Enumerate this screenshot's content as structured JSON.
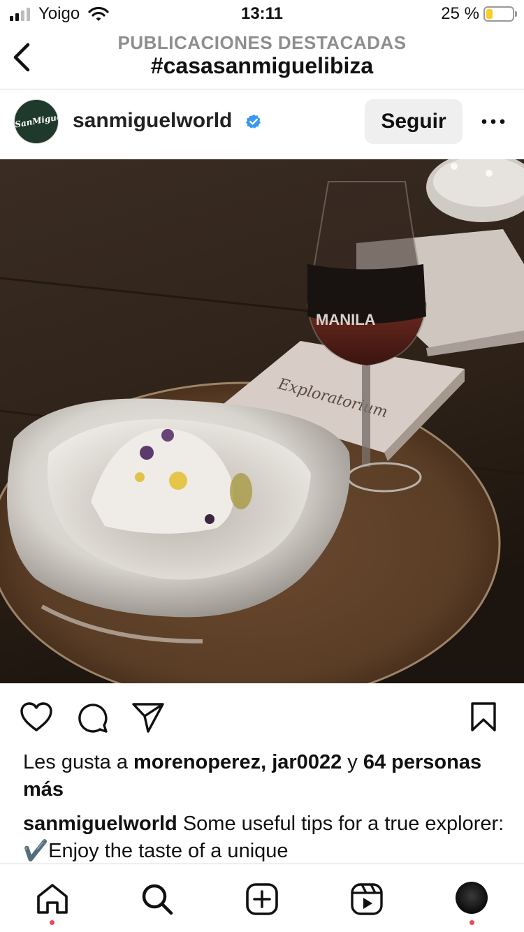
{
  "status_bar": {
    "carrier": "Yoigo",
    "time": "13:11",
    "battery_pct_text": "25 %",
    "battery_level": 0.25,
    "signal_bars_active": 2,
    "signal_bars_total": 4,
    "battery_color": "#f7cf24"
  },
  "header": {
    "subtitle": "PUBLICACIONES DESTACADAS",
    "title": "#casasanmiguelibiza",
    "back_icon": "chevron-left-icon"
  },
  "post": {
    "username": "sanmiguelworld",
    "verified": true,
    "verified_color": "#3897f0",
    "follow_label": "Seguir",
    "more_icon": "more-horizontal-icon",
    "avatar_text": "SanMiguel",
    "photo_texts": {
      "glass_print": "MANILA",
      "card_print": "Exploratorium"
    }
  },
  "actions": {
    "like_icon": "heart-icon",
    "comment_icon": "comment-icon",
    "share_icon": "send-icon",
    "save_icon": "bookmark-icon"
  },
  "likes": {
    "prefix": "Les gusta a ",
    "users": "morenoperez, jar0022",
    "connector": " y ",
    "others": "64 personas más"
  },
  "caption": {
    "username": "sanmiguelworld",
    "text": " Some useful tips for a true explorer: ✔️Enjoy the taste of a unique"
  },
  "tabbar": {
    "items": [
      {
        "icon": "home-icon",
        "notification": true
      },
      {
        "icon": "search-icon",
        "notification": false
      },
      {
        "icon": "new-post-icon",
        "notification": false
      },
      {
        "icon": "reels-icon",
        "notification": false
      },
      {
        "icon": "profile-avatar",
        "notification": true
      }
    ],
    "notification_color": "#ed4956"
  }
}
